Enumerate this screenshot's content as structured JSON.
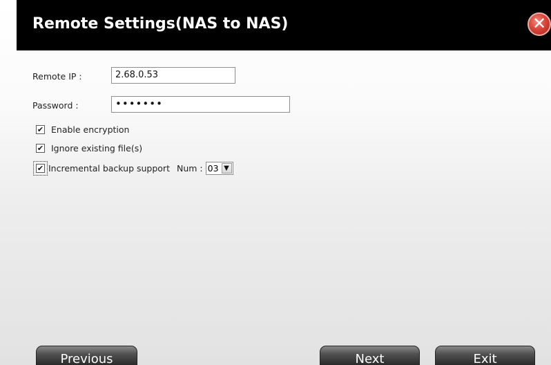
{
  "dialog": {
    "title": "Remote Settings(NAS to NAS)",
    "close_icon": "close-icon"
  },
  "form": {
    "remote_ip_label": "Remote IP :",
    "remote_ip_value": "2.68.0.53",
    "password_label": "Password :",
    "password_value": "•••••••",
    "enable_encryption_label": "Enable encryption",
    "enable_encryption_checked": true,
    "ignore_existing_label": "Ignore existing file(s)",
    "ignore_existing_checked": true,
    "incremental_label": "Incremental backup support",
    "incremental_checked": true,
    "num_label": "Num :",
    "num_value": "03"
  },
  "buttons": {
    "previous": "Previous",
    "next": "Next",
    "exit": "Exit"
  },
  "colors": {
    "titlebar": "#000000",
    "close_button": "#d9453a",
    "button": "#3a3a3a"
  }
}
